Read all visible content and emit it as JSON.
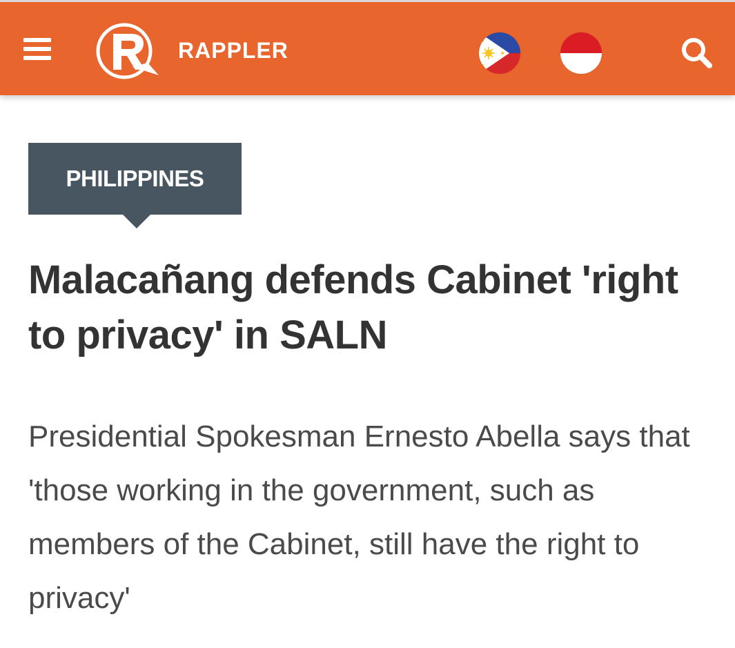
{
  "header": {
    "brand_name": "RAPPLER",
    "background_color": "#e8652d",
    "menu_icon": "hamburger-menu-icon",
    "search_icon": "search-icon",
    "editions": [
      {
        "icon": "philippines-flag-icon"
      },
      {
        "icon": "indonesia-flag-icon"
      }
    ]
  },
  "article": {
    "section": "PHILIPPINES",
    "section_color": "#475660",
    "headline": "Malacañang defends Cabinet 'right to privacy' in SALN",
    "summary": "Presidential Spokesman Ernesto Abella says that 'those working in the government, such as members of the Cabinet, still have the right to privacy'"
  }
}
